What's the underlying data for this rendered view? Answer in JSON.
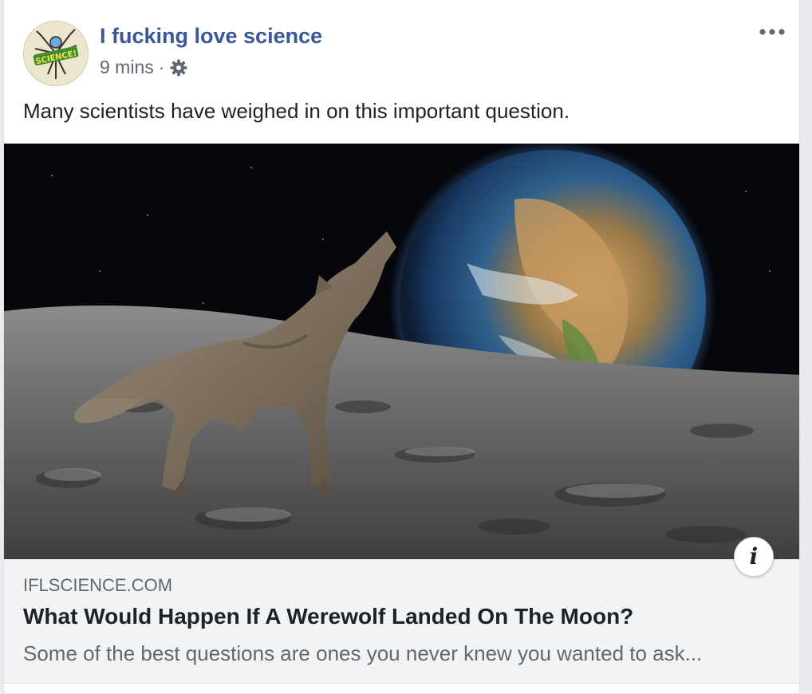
{
  "post": {
    "page_name": "I fucking love science",
    "timestamp": "9 mins",
    "separator": "·",
    "caption": "Many scientists have weighed in on this important question.",
    "privacy_icon": "gear-icon",
    "more_icon": "ellipsis-icon"
  },
  "avatar": {
    "logo_text": "SCIENCE!",
    "icon": "page-avatar-logo"
  },
  "image": {
    "description_icon": "wolf-on-moon-image"
  },
  "link_preview": {
    "domain": "IFLSCIENCE.COM",
    "title": "What Would Happen If A Werewolf Landed On The Moon?",
    "description": "Some of the best questions are ones you never knew you wanted to ask...",
    "info_label": "i"
  },
  "colors": {
    "page_name": "#385898",
    "text": "#1d2129",
    "muted": "#616770",
    "link_box_bg": "#f2f3f5"
  }
}
